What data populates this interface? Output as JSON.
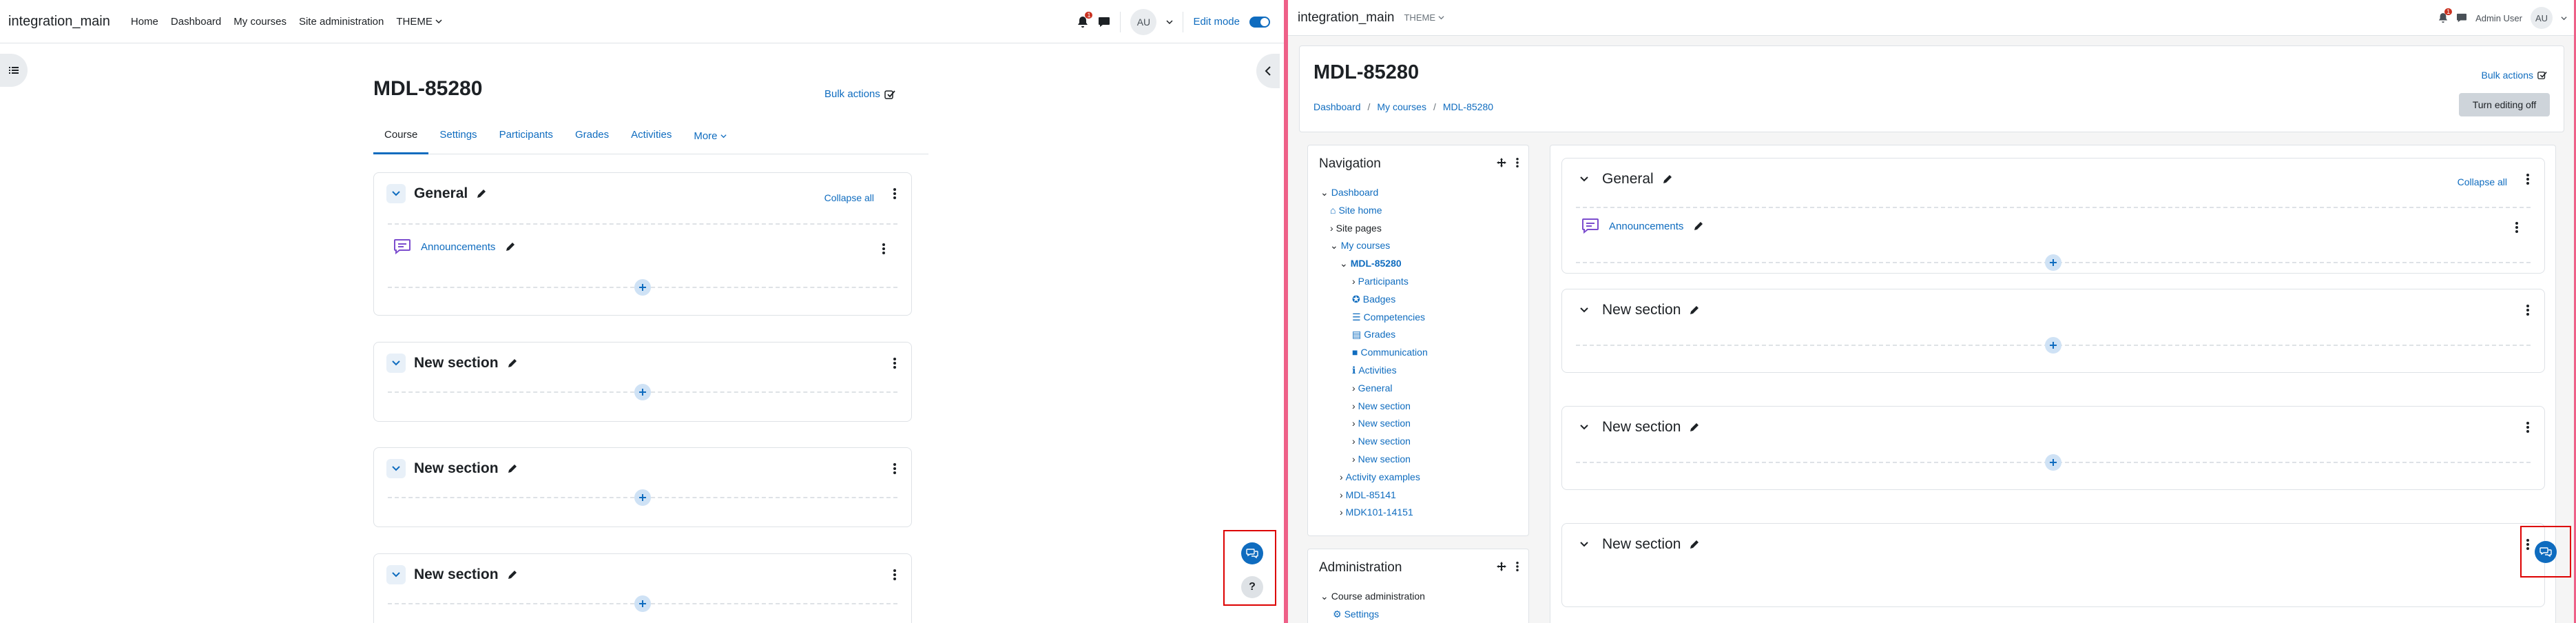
{
  "left": {
    "brand": "integration_main",
    "menu": [
      "Home",
      "Dashboard",
      "My courses",
      "Site administration",
      "THEME"
    ],
    "notification_count": "1",
    "avatar": "AU",
    "edit_mode_label": "Edit mode",
    "course_title": "MDL-85280",
    "bulk_actions": "Bulk actions",
    "tabs": [
      "Course",
      "Settings",
      "Participants",
      "Grades",
      "Activities",
      "More"
    ],
    "collapse_all": "Collapse all",
    "sections": [
      "General",
      "New section",
      "New section",
      "New section"
    ],
    "activity": "Announcements",
    "help_icon_label": "?"
  },
  "right": {
    "brand": "integration_main",
    "theme": "THEME",
    "user_name": "Admin User",
    "avatar": "AU",
    "course_title": "MDL-85280",
    "breadcrumbs": [
      "Dashboard",
      "My courses",
      "MDL-85280"
    ],
    "bulk_actions": "Bulk actions",
    "editing_button": "Turn editing off",
    "navigation_title": "Navigation",
    "nav_tree": [
      "Dashboard",
      "Site home",
      "Site pages",
      "My courses",
      "MDL-85280",
      "Participants",
      "Badges",
      "Competencies",
      "Grades",
      "Communication",
      "Activities",
      "General",
      "New section",
      "New section",
      "New section",
      "New section",
      "Activity examples",
      "MDL-85141",
      "MDK101-14151"
    ],
    "administration_title": "Administration",
    "admin_tree": [
      "Course administration",
      "Settings"
    ],
    "collapse_all": "Collapse all",
    "sections": [
      "General",
      "New section",
      "New section",
      "New section"
    ],
    "activity": "Announcements"
  },
  "colors": {
    "accent": "#0f6cbf",
    "highlight": "#d00000",
    "divider": "#ee6088"
  }
}
